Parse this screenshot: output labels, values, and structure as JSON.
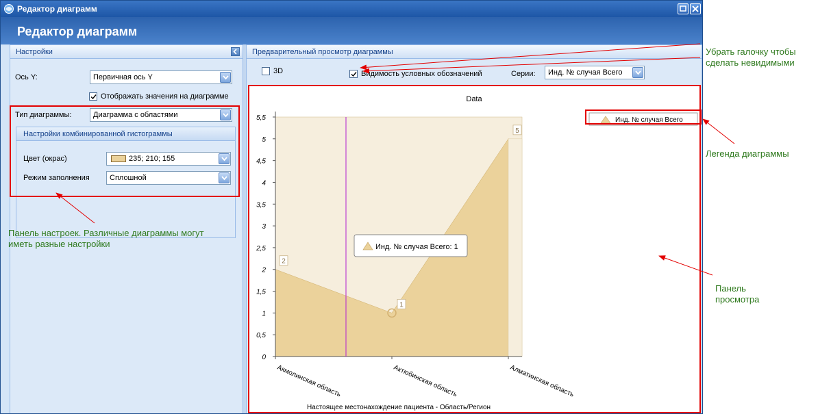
{
  "window": {
    "title": "Редактор диаграмм",
    "header_title": "Редактор диаграмм"
  },
  "settings_panel": {
    "title": "Настройки",
    "y_axis_label": "Ось Y:",
    "y_axis_value": "Первичная ось Y",
    "show_values_label": "Отображать значения на диаграмме",
    "show_values_checked": true,
    "chart_type_label": "Тип диаграммы:",
    "chart_type_value": "Диаграмма с областями",
    "combo_settings_title": "Настройки комбинированной гистограммы",
    "color_label": "Цвет (окрас)",
    "color_value": "235; 210; 155",
    "color_swatch": "#ebd29b",
    "fill_mode_label": "Режим заполнения",
    "fill_mode_value": "Сплошной"
  },
  "preview_panel": {
    "title": "Предварительный просмотр диаграммы",
    "checkbox_3d_label": "3D",
    "checkbox_3d_checked": false,
    "legend_visibility_label": "Видимость условных обозначений",
    "legend_visibility_checked": true,
    "series_label": "Серии:",
    "series_value": "Инд. № случая Всего"
  },
  "chart_data": {
    "type": "area",
    "title": "Data",
    "xlabel": "Настоящее местонахождение пациента - Область/Регион",
    "ylabel": "",
    "categories": [
      "Акмолинская область",
      "Актюбинская область",
      "Алматинская область"
    ],
    "series": [
      {
        "name": "Инд. № случая Всего",
        "values": [
          2,
          1,
          5
        ],
        "color": "#ebd29b"
      }
    ],
    "ylim": [
      0,
      5.5
    ],
    "yticks": [
      "0",
      "0,5",
      "1",
      "1,5",
      "2",
      "2,5",
      "3",
      "3,5",
      "4",
      "4,5",
      "5",
      "5,5"
    ],
    "data_labels": [
      "2",
      "1",
      "5"
    ],
    "tooltip": "Инд. № случая Всего: 1",
    "legend_entry": "Инд. № случая Всего",
    "legend_position": "top-right"
  },
  "annotations": {
    "uncheck_note": "Убрать галочку чтобы сделать невидимыми",
    "legend_note": "Легенда диаграммы",
    "settings_note": "Панель настроек. Различные диаграммы могут иметь разные настройки",
    "preview_note": "Панель просмотра"
  },
  "colors": {
    "accent": "#1d56a6",
    "highlight": "#e30000",
    "note_text": "#2f7a1e",
    "area_fill": "#ebd29b",
    "area_back": "#f6eedd",
    "crosshair": "#b020d0"
  }
}
